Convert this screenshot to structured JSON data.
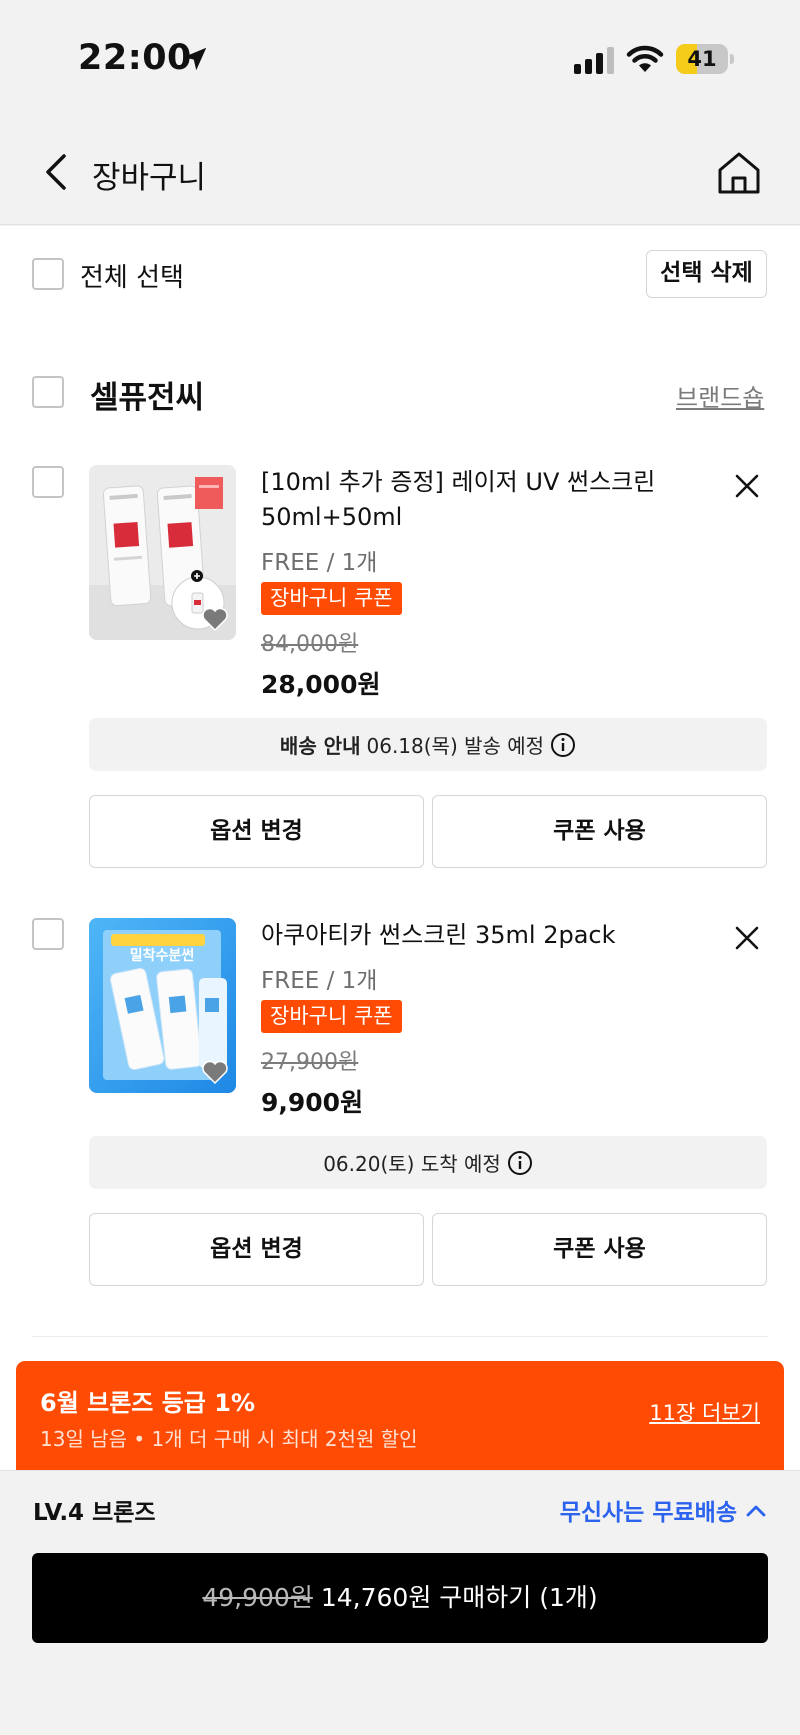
{
  "status_bar": {
    "time": "22:00",
    "battery": "41",
    "battery_level": 0.41
  },
  "nav": {
    "title": "장바구니"
  },
  "select_all": {
    "label": "전체 선택",
    "delete_label": "선택 삭제"
  },
  "brand": {
    "name": "셀퓨전씨",
    "shop_link": "브랜드숍"
  },
  "items": [
    {
      "title_line1": "[10ml 추가 증정] 레이저 UV 썬스크린",
      "title_line2": "50ml+50ml",
      "option": "FREE / 1개",
      "coupon_badge": "장바구니 쿠폰",
      "original_price": "84,000원",
      "price": "28,000원",
      "shipping_label": "배송 안내",
      "shipping_text": "06.18(목) 발송 예정",
      "option_button": "옵션 변경",
      "coupon_button": "쿠폰 사용"
    },
    {
      "title_line1": "아쿠아티카 썬스크린 35ml 2pack",
      "option": "FREE / 1개",
      "coupon_badge": "장바구니 쿠폰",
      "original_price": "27,900원",
      "price": "9,900원",
      "thumb_text": "밀착수분썬",
      "shipping_text": "06.20(토) 도착 예정",
      "option_button": "옵션 변경",
      "coupon_button": "쿠폰 사용"
    }
  ],
  "promo": {
    "title": "6월 브론즈 등급 1%",
    "subtitle": "13일 남음 • 1개 더 구매 시 최대 2천원 할인",
    "more_link": "11장 더보기"
  },
  "bottom": {
    "level": "LV.4 브론즈",
    "free_shipping": "무신사는 무료배송",
    "buy": {
      "original_price": "49,900원",
      "label": "14,760원 구매하기 (1개)"
    }
  },
  "colors": {
    "accent": "#ff4b03",
    "link_blue": "#2b63ee",
    "battery_yellow": "#f5cc1a"
  }
}
